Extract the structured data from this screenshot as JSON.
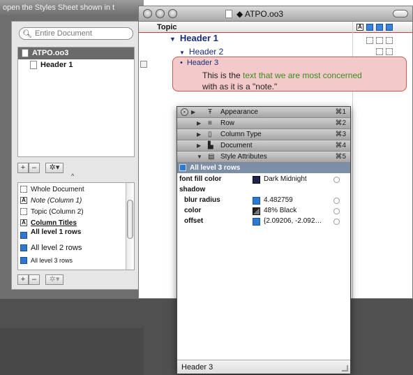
{
  "left_window": {
    "title_fragment": "open the Styles Sheet shown in t",
    "search_placeholder": "Entire Document",
    "documents": [
      {
        "label": "ATPO.oo3",
        "selected": true
      },
      {
        "label": "Header 1",
        "selected": false
      }
    ],
    "add_label": "+",
    "remove_label": "–",
    "action_label": "✲▾",
    "collapse_glyph": "^",
    "styles": [
      {
        "label": "Whole Document",
        "icon": "dashed-box-icon"
      },
      {
        "label": "Note (Column 1)",
        "icon": "a-box-icon"
      },
      {
        "label": "Topic (Column 2)",
        "icon": "dashed-box-icon"
      },
      {
        "label": "Column Titles",
        "icon": "a-box-icon"
      },
      {
        "label": "All level 1 rows",
        "icon": "blue-style-icon"
      },
      {
        "label": "All level 2 rows",
        "icon": "blue-style-icon"
      },
      {
        "label": "All level 3 rows",
        "icon": "blue-style-icon"
      }
    ]
  },
  "main_window": {
    "title": "ATPO.oo3",
    "title_prefix": "◆",
    "column_topic": "Topic",
    "header1": "Header 1",
    "header2": "Header 2",
    "header3": "Header 3",
    "note_part1": "This is the ",
    "note_highlight": "text that we are most concerned",
    "note_line2": "with as it is a \"note.\"",
    "expand_glyph": "▼",
    "bullet_glyph": "•"
  },
  "inspector": {
    "sections": [
      {
        "label": "Appearance",
        "shortcut": "⌘1",
        "glyph": "Ŧ",
        "tri": "▶"
      },
      {
        "label": "Row",
        "shortcut": "⌘2",
        "glyph": "≡",
        "tri": "▶"
      },
      {
        "label": "Column Type",
        "shortcut": "⌘3",
        "glyph": "▯",
        "tri": "▶"
      },
      {
        "label": "Document",
        "shortcut": "⌘4",
        "glyph": "▙",
        "tri": "▶"
      },
      {
        "label": "Style Attributes",
        "shortcut": "⌘5",
        "glyph": "▤",
        "tri": "▼"
      }
    ],
    "close_glyph": "×",
    "header_tri": "▶",
    "selected_style": "All level 3 rows",
    "attributes": {
      "font_fill_color_label": "font fill color",
      "font_fill_color_value": "Dark Midnight",
      "font_fill_color_swatch": "#1f2451",
      "shadow_label": "shadow",
      "blur_radius_label": "blur radius",
      "blur_radius_value": "4.482759",
      "color_label": "color",
      "color_value": "48% Black",
      "color_swatch": "#4a4a4a",
      "offset_label": "offset",
      "offset_value": "{2.09206, -2.092…"
    },
    "footer": "Header 3"
  },
  "colors": {
    "accent_blue": "#2f78d2",
    "note_bg": "#f4c9c9",
    "note_border": "#d05555",
    "highlight_green": "#3d8a22"
  }
}
